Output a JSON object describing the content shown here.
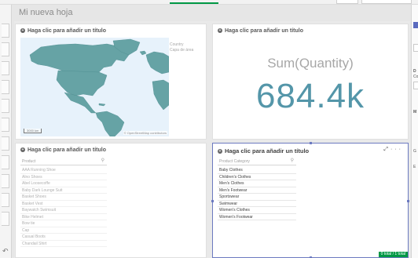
{
  "sheet": {
    "title": "Mi nueva hoja"
  },
  "tiles": {
    "map": {
      "title": "Haga clic para añadir un título",
      "legend": [
        "Country",
        "Capa de área"
      ],
      "scale": "3000 km",
      "attribution": "© OpenStreetMap contributors",
      "land_color": "#66a3a5"
    },
    "kpi": {
      "title": "Haga clic para añadir un título",
      "measure_label": "Sum(Quantity)",
      "value": "684.4k",
      "value_color": "#5496a9"
    },
    "product_list": {
      "title": "Haga clic para añadir un título",
      "search_placeholder": "Product",
      "items": [
        "AAA Running Shoe",
        "Alno Shoes",
        "Abel Loosecoffe",
        "Baby Dark Lounge Suit",
        "Basket Shoes",
        "Basket Vest",
        "Baywatch Swimsuit",
        "Bike Helmet",
        "Bow tie",
        "Cap",
        "Casual Boots",
        "Chandail Shirt"
      ]
    },
    "category_list": {
      "title": "Haga clic para añadir un título",
      "search_placeholder": "Product Category",
      "items": [
        "Baby Clothes",
        "Children's Clothes",
        "Men's Clothes",
        "Men's Footwear",
        "Sportswear",
        "Swimwear",
        "Women's Clothes",
        "Women's Footwear"
      ],
      "badge": "0 total / 1 total",
      "tools": [
        "expand-icon",
        "more-icon"
      ]
    }
  },
  "right_panel": {
    "labels": [
      "D",
      "Co",
      "M",
      "G",
      "E"
    ]
  },
  "colors": {
    "accent_green": "#009845",
    "selection_border": "#6c7ac0"
  }
}
